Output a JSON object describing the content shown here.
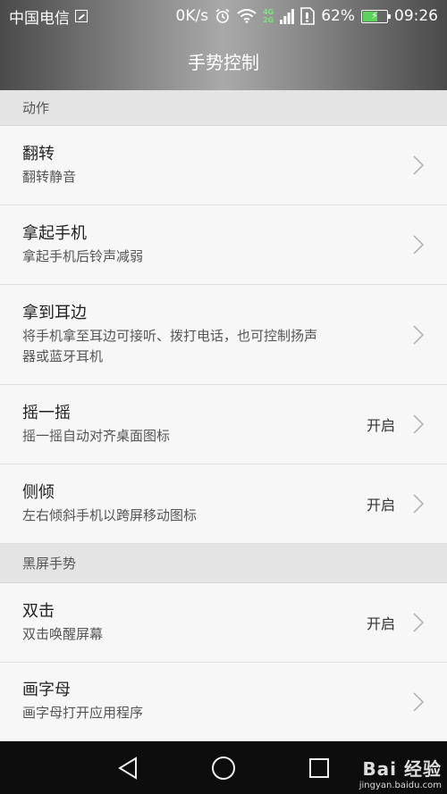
{
  "status_bar": {
    "carrier": "中国电信",
    "speed": "0K/s",
    "net_top": "4G",
    "net_bottom": "2G",
    "battery_percent": "62%",
    "battery_level": 0.62,
    "time": "09:26"
  },
  "header": {
    "title": "手势控制"
  },
  "sections": [
    {
      "label": "动作",
      "items": [
        {
          "title": "翻转",
          "subtitle": "翻转静音",
          "status": ""
        },
        {
          "title": "拿起手机",
          "subtitle": "拿起手机后铃声减弱",
          "status": ""
        },
        {
          "title": "拿到耳边",
          "subtitle_line1": "将手机拿至耳边可接听、拨打电话，也可控制扬声",
          "subtitle_line2": "器或蓝牙耳机",
          "status": ""
        },
        {
          "title": "摇一摇",
          "subtitle": "摇一摇自动对齐桌面图标",
          "status": "开启"
        },
        {
          "title": "侧倾",
          "subtitle": "左右倾斜手机以跨屏移动图标",
          "status": "开启"
        }
      ]
    },
    {
      "label": "黑屏手势",
      "items": [
        {
          "title": "双击",
          "subtitle": "双击唤醒屏幕",
          "status": "开启"
        },
        {
          "title": "画字母",
          "subtitle": "画字母打开应用程序",
          "status": ""
        }
      ]
    }
  ],
  "watermark": {
    "main": "Bai 经验",
    "sub": "jingyan.baidu.com"
  },
  "colors": {
    "header_bg": "#8e8e8e",
    "section_bg": "#e4e4e4",
    "row_bg": "#f7f7f7",
    "nav_bg": "#0d0d0d",
    "battery_green": "#5bd35b"
  }
}
